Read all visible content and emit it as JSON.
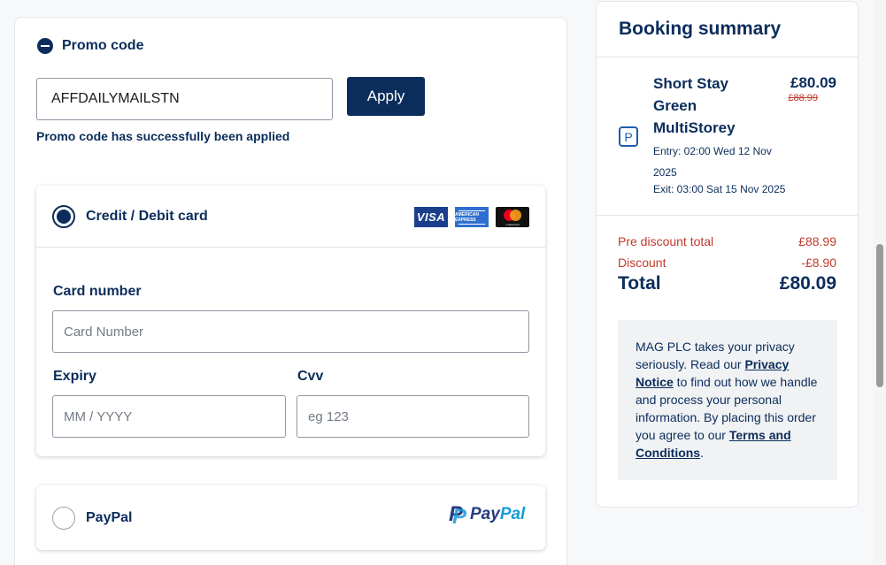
{
  "promo": {
    "title": "Promo code",
    "input_value": "AFFDAILYMAILSTN",
    "apply_label": "Apply",
    "success_message": "Promo code has successfully been applied"
  },
  "payment": {
    "card": {
      "label": "Credit / Debit card",
      "logos": [
        "VISA",
        "AMERICAN EXPRESS",
        "mastercard"
      ],
      "card_number_label": "Card number",
      "card_number_placeholder": "Card Number",
      "expiry_label": "Expiry",
      "expiry_placeholder": "MM / YYYY",
      "cvv_label": "Cvv",
      "cvv_placeholder": "eg 123"
    },
    "paypal": {
      "label": "PayPal",
      "logo_pay": "Pay",
      "logo_pal": "Pal"
    }
  },
  "summary": {
    "title": "Booking summary",
    "product_name": "Short Stay Green MultiStorey",
    "price_now": "£80.09",
    "price_was": "£88.99",
    "parking_icon": "P",
    "entry": "Entry: 02:00 Wed 12 Nov 2025",
    "exit": "Exit: 03:00 Sat 15 Nov 2025",
    "pre_discount_label": "Pre discount total",
    "pre_discount_value": "£88.99",
    "discount_label": "Discount",
    "discount_value": "-£8.90",
    "total_label": "Total",
    "total_value": "£80.09",
    "privacy": {
      "text1": "MAG PLC takes your privacy seriously. Read our ",
      "link1": "Privacy Notice",
      "text2": " to find out how we handle and process your personal information. By placing this order you agree to our ",
      "link2": "Terms and Conditions",
      "text3": "."
    }
  },
  "colors": {
    "brand_navy": "#0b2d5b",
    "discount_red": "#c0392b",
    "visa_blue": "#1a3e8c",
    "amex_blue": "#2f6fd1",
    "paypal_dark": "#253b80",
    "paypal_light": "#179bd7"
  }
}
